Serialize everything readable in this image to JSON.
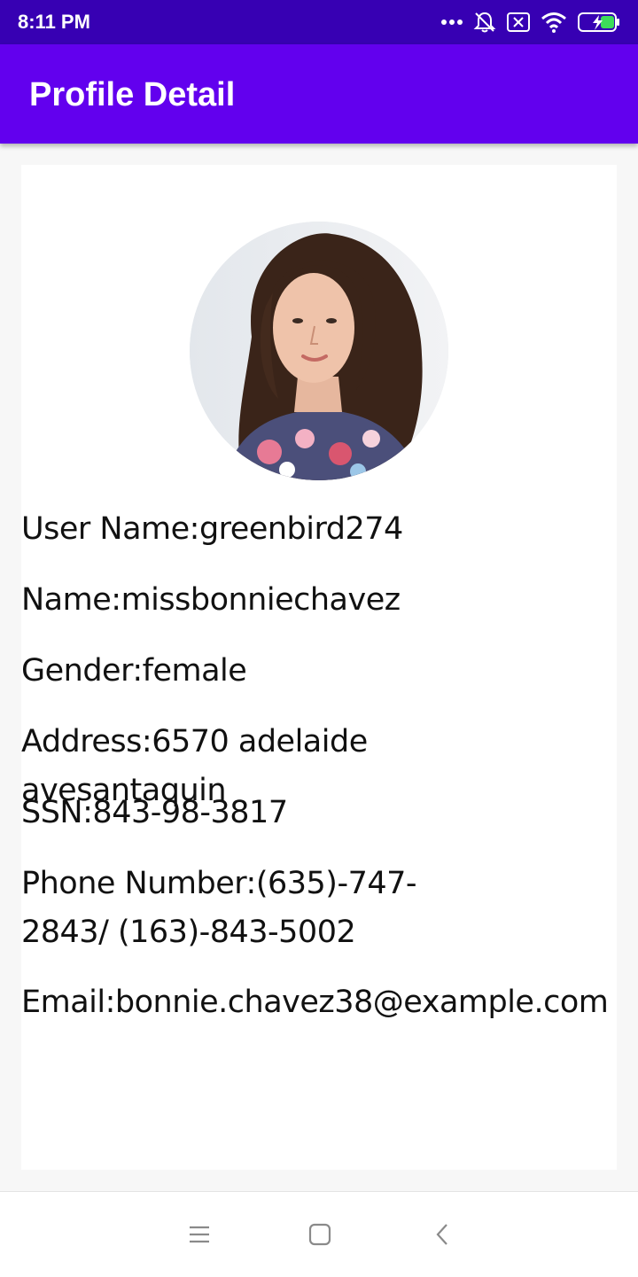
{
  "status_bar": {
    "time": "8:11 PM",
    "icons": [
      "more-dots-icon",
      "mute-icon",
      "sim-x-icon",
      "wifi-icon",
      "battery-charging-icon"
    ]
  },
  "app_bar": {
    "title": "Profile Detail"
  },
  "profile": {
    "avatar": "profile-photo",
    "fields": [
      {
        "label": "User Name:",
        "value": "greenbird274"
      },
      {
        "label": "Name:",
        "value": "missbonniechavez"
      },
      {
        "label": "Gender:",
        "value": "female"
      },
      {
        "label": "Address:",
        "value": "6570 adelaide avesantaquin"
      },
      {
        "label": "SSN:",
        "value": "843-98-3817"
      },
      {
        "label": "Phone Number:",
        "value": "(635)-747-2843/ (163)-843-5002"
      },
      {
        "label": "Email:",
        "value": "bonnie.chavez38@example.com"
      }
    ]
  },
  "nav_bar": {
    "buttons": [
      "menu-icon",
      "home-icon",
      "back-icon"
    ]
  },
  "colors": {
    "status_bar": "#3700b3",
    "app_bar": "#6200ee",
    "background": "#f7f7f7",
    "card": "#ffffff"
  }
}
